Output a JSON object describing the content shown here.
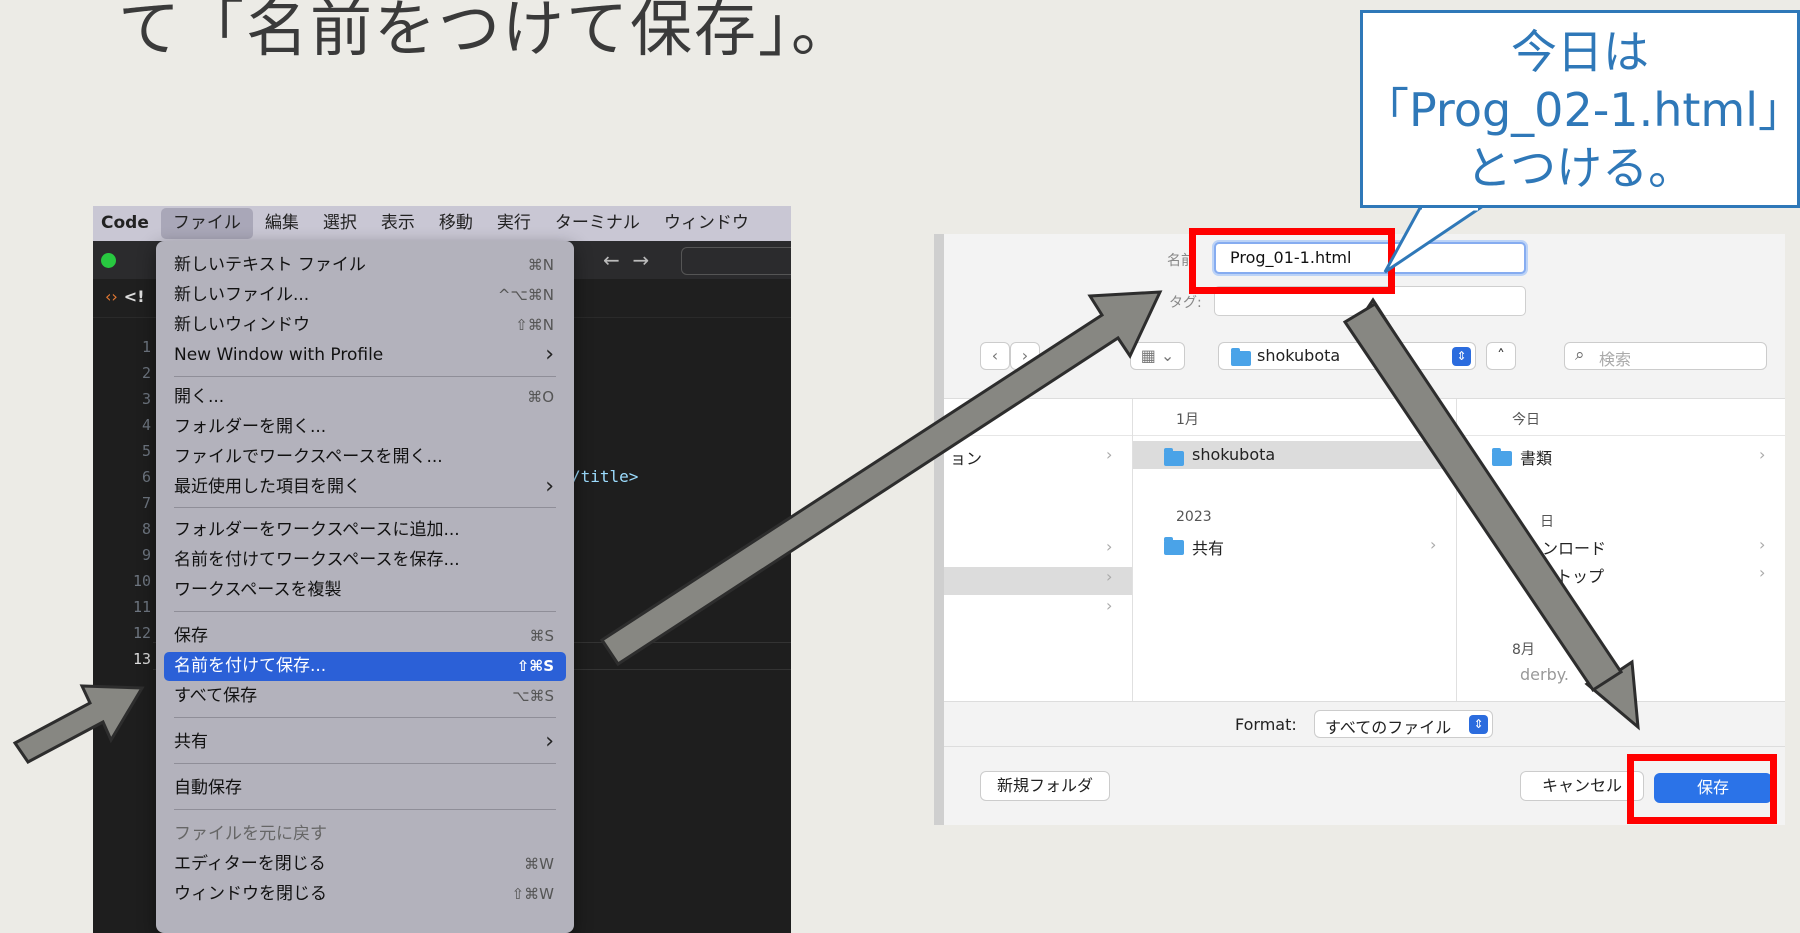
{
  "slide": {
    "title": "て「名前をつけて保存」。"
  },
  "callout": {
    "lines": [
      "今日は",
      "「Prog_02-1.html」",
      "とつける。"
    ]
  },
  "vscode": {
    "menubar": [
      "Code",
      "ファイル",
      "編集",
      "選択",
      "表示",
      "移動",
      "実行",
      "ターミナル",
      "ウィンドウ"
    ],
    "tab_label": "<!",
    "line_numbers": [
      "1",
      "2",
      "3",
      "4",
      "5",
      "6",
      "7",
      "8",
      "9",
      "10",
      "11",
      "12",
      "13"
    ],
    "code_fragment": "/title>",
    "file_menu": [
      {
        "label": "新しいテキスト ファイル",
        "shortcut": "⌘N"
      },
      {
        "label": "新しいファイル...",
        "shortcut": "^⌥⌘N"
      },
      {
        "label": "新しいウィンドウ",
        "shortcut": "⇧⌘N"
      },
      {
        "label": "New Window with Profile",
        "arrow": "›"
      },
      {
        "label": "開く...",
        "shortcut": "⌘O"
      },
      {
        "label": "フォルダーを開く..."
      },
      {
        "label": "ファイルでワークスペースを開く..."
      },
      {
        "label": "最近使用した項目を開く",
        "arrow": "›"
      },
      {
        "label": "フォルダーをワークスペースに追加..."
      },
      {
        "label": "名前を付けてワークスペースを保存..."
      },
      {
        "label": "ワークスペースを複製"
      },
      {
        "label": "保存",
        "shortcut": "⌘S"
      },
      {
        "label": "名前を付けて保存...",
        "shortcut": "⇧⌘S"
      },
      {
        "label": "すべて保存",
        "shortcut": "⌥⌘S"
      },
      {
        "label": "共有",
        "arrow": "›"
      },
      {
        "label": "自動保存"
      },
      {
        "label": "ファイルを元に戻す"
      },
      {
        "label": "エディターを閉じる",
        "shortcut": "⌘W"
      },
      {
        "label": "ウィンドウを閉じる",
        "shortcut": "⇧⌘W"
      }
    ]
  },
  "dialog": {
    "name_label": "名前",
    "name_value": "Prog_01-1.html",
    "tags_label": "タグ:",
    "location": "shokubota",
    "search_placeholder": "検索",
    "columns": {
      "col1": {
        "partial_item": "ョン"
      },
      "col2": {
        "header": "1月",
        "items": [
          "shokubota"
        ],
        "group2_header": "2023",
        "group2_items": [
          "共有"
        ]
      },
      "col3": {
        "header": "今日",
        "items": [
          "書類"
        ],
        "group2_header": "日",
        "group2_items": [
          "ンロード",
          "トップ"
        ],
        "group3_header": "8月",
        "group3_items": [
          "derby."
        ]
      }
    },
    "format_label": "Format:",
    "format_value": "すべてのファイル",
    "new_folder": "新規フォルダ",
    "cancel": "キャンセル",
    "save": "保存"
  },
  "colors": {
    "callout": "#2f78b8",
    "highlight": "#ff0000",
    "menu_highlight": "#2b60d7",
    "arrow_fill": "#878782"
  }
}
